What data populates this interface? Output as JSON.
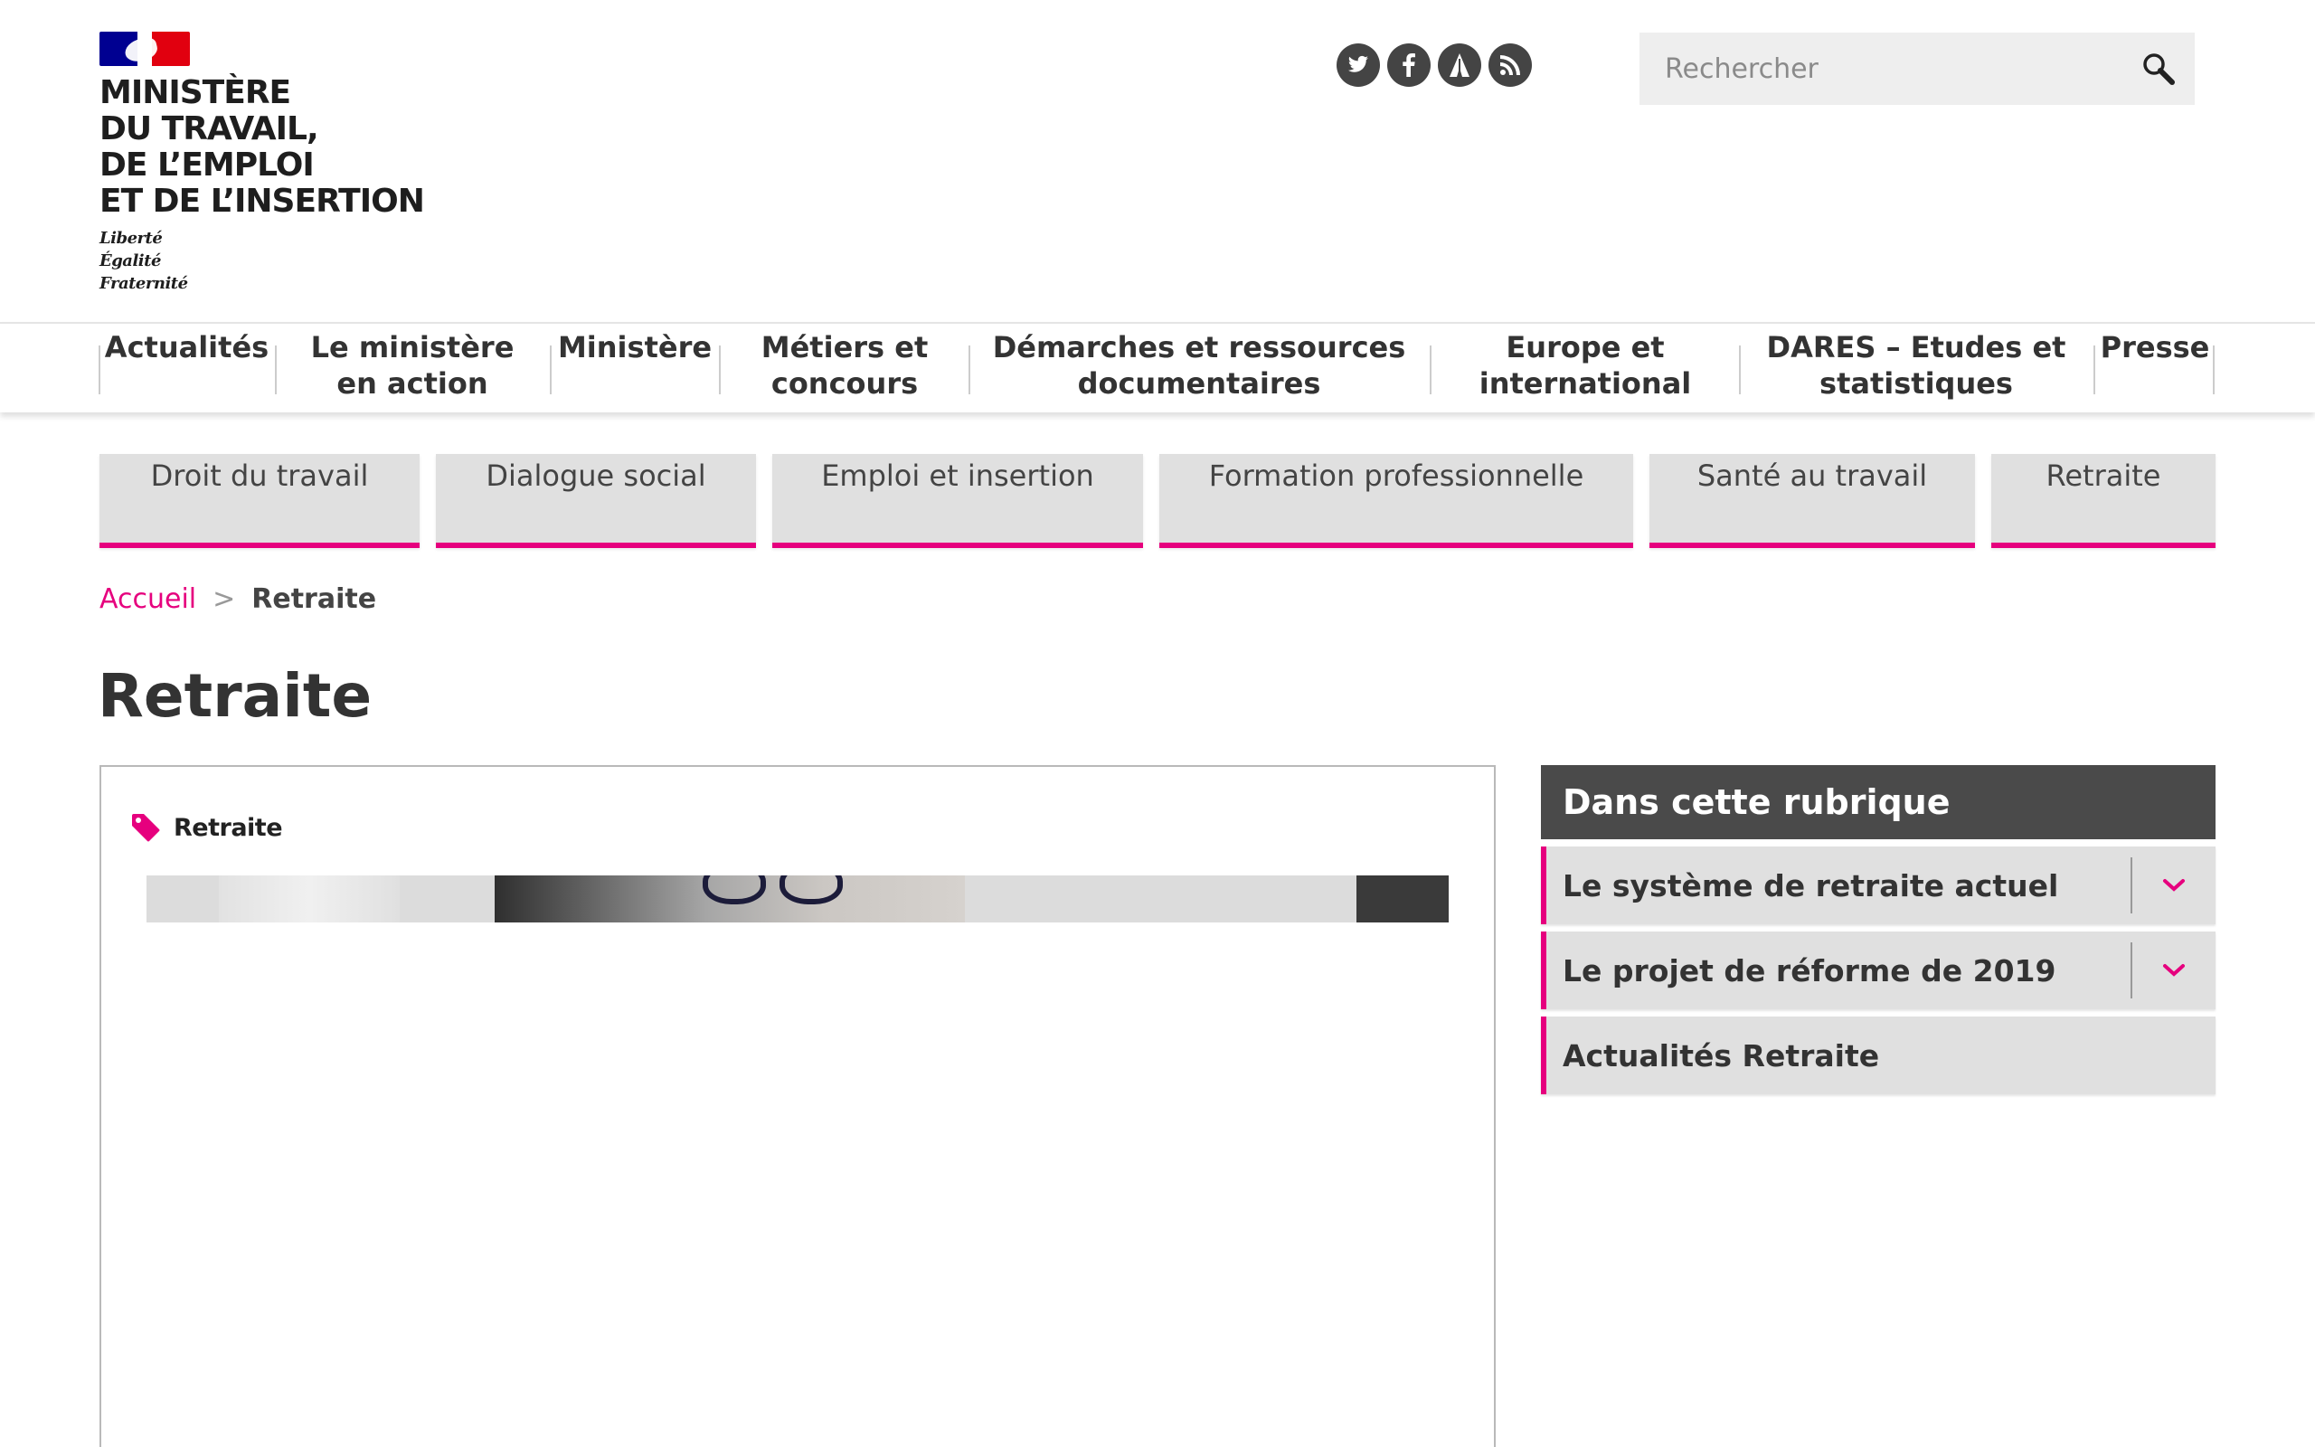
{
  "header": {
    "ministry_lines": [
      "MINISTÈRE",
      "DU TRAVAIL,",
      "DE L’EMPLOI",
      "ET DE L’INSERTION"
    ],
    "motto": [
      "Liberté",
      "Égalité",
      "Fraternité"
    ],
    "flag_colors": [
      "#000091",
      "#ffffff",
      "#e1000f"
    ],
    "socials": [
      {
        "icon": "twitter-icon",
        "glyph": "🐦"
      },
      {
        "icon": "facebook-icon",
        "glyph": "f"
      },
      {
        "icon": "dailymotion-icon",
        "glyph": "▲"
      },
      {
        "icon": "rss-icon",
        "glyph": "◔"
      }
    ],
    "search": {
      "placeholder": "Rechercher",
      "icon": "search-icon"
    }
  },
  "main_nav": [
    {
      "label": "Actualités"
    },
    {
      "label": "Le ministère en action"
    },
    {
      "label": "Ministère"
    },
    {
      "label": "Métiers et concours"
    },
    {
      "label": "Démarches et ressources documentaires"
    },
    {
      "label": "Europe et international"
    },
    {
      "label": "DARES – Etudes et statistiques"
    },
    {
      "label": "Presse"
    }
  ],
  "sub_nav": [
    {
      "label": "Droit du travail"
    },
    {
      "label": "Dialogue social"
    },
    {
      "label": "Emploi et insertion"
    },
    {
      "label": "Formation professionnelle"
    },
    {
      "label": "Santé au travail"
    },
    {
      "label": "Retraite"
    }
  ],
  "breadcrumb": {
    "home": "Accueil",
    "separator": ">",
    "current": "Retraite"
  },
  "page_title": "Retraite",
  "article": {
    "tag": "Retraite",
    "tag_icon": "tag-icon"
  },
  "sidebar": {
    "heading": "Dans cette rubrique",
    "items": [
      {
        "label": "Le système de retraite actuel",
        "expandable": true
      },
      {
        "label": "Le projet de réforme de 2019",
        "expandable": true
      },
      {
        "label": "Actualités Retraite",
        "expandable": false
      }
    ]
  },
  "colors": {
    "accent": "#e6007e",
    "sidebar_head": "#4a4a4a",
    "tab_bg": "#e0e0e0"
  }
}
